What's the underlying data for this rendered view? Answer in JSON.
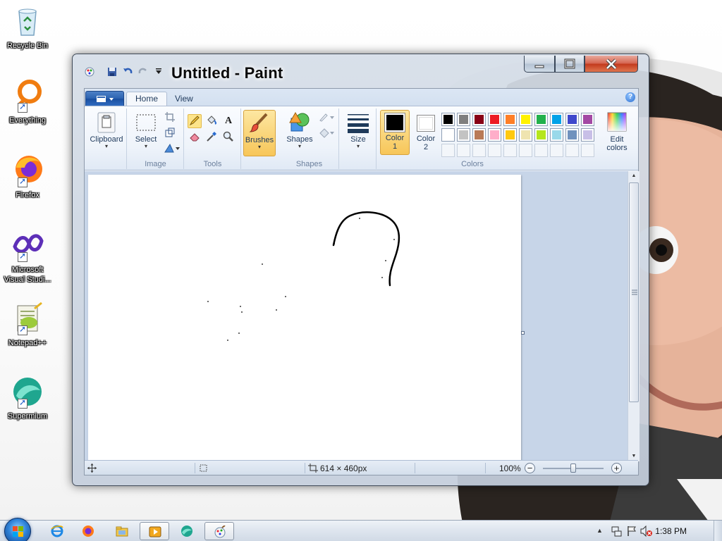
{
  "desktop": {
    "icons": [
      {
        "label": "Recycle Bin",
        "icon": "recycle-bin-icon"
      },
      {
        "label": "Everything",
        "icon": "everything-icon"
      },
      {
        "label": "Firefox",
        "icon": "firefox-icon"
      },
      {
        "label": "Microsoft Visual Studi...",
        "icon": "visual-studio-icon"
      },
      {
        "label": "Notepad++",
        "icon": "notepad-plus-plus-icon"
      },
      {
        "label": "Supermium",
        "icon": "supermium-icon"
      }
    ]
  },
  "window": {
    "title": "Untitled - Paint"
  },
  "ribbon": {
    "tabs": [
      "Home",
      "View"
    ],
    "active_tab": "Home",
    "groups": {
      "clipboard": {
        "button": "Clipboard"
      },
      "image": {
        "select": "Select",
        "label": "Image"
      },
      "tools": {
        "label": "Tools"
      },
      "brushes": {
        "button": "Brushes"
      },
      "shapes": {
        "button": "Shapes",
        "label": "Shapes"
      },
      "size": {
        "button": "Size"
      },
      "colors": {
        "color1_label": "Color",
        "color1_index": "1",
        "color2_label": "Color",
        "color2_index": "2",
        "edit_label": "Edit",
        "edit_label2": "colors",
        "label": "Colors",
        "color1": "#000000",
        "color2": "#ffffff",
        "palette_row1": [
          "#000000",
          "#7f7f7f",
          "#880015",
          "#ed1c24",
          "#ff7f27",
          "#fff200",
          "#22b14c",
          "#00a2e8",
          "#3f48cc",
          "#a349a4"
        ],
        "palette_row2": [
          "#ffffff",
          "#c3c3c3",
          "#b97a57",
          "#ffaec9",
          "#ffc90e",
          "#efe4b0",
          "#b5e61d",
          "#99d9ea",
          "#7092be",
          "#c8bfe7"
        ]
      }
    }
  },
  "statusbar": {
    "dimensions": "614 × 460px",
    "zoom": "100%",
    "zoom_out_symbol": "−",
    "zoom_in_symbol": "+"
  },
  "taskbar": {
    "clock": "1:38 PM",
    "pinned": [
      "internet-explorer-icon",
      "firefox-icon",
      "file-explorer-icon",
      "media-player-icon",
      "supermium-icon",
      "paint-icon"
    ]
  }
}
